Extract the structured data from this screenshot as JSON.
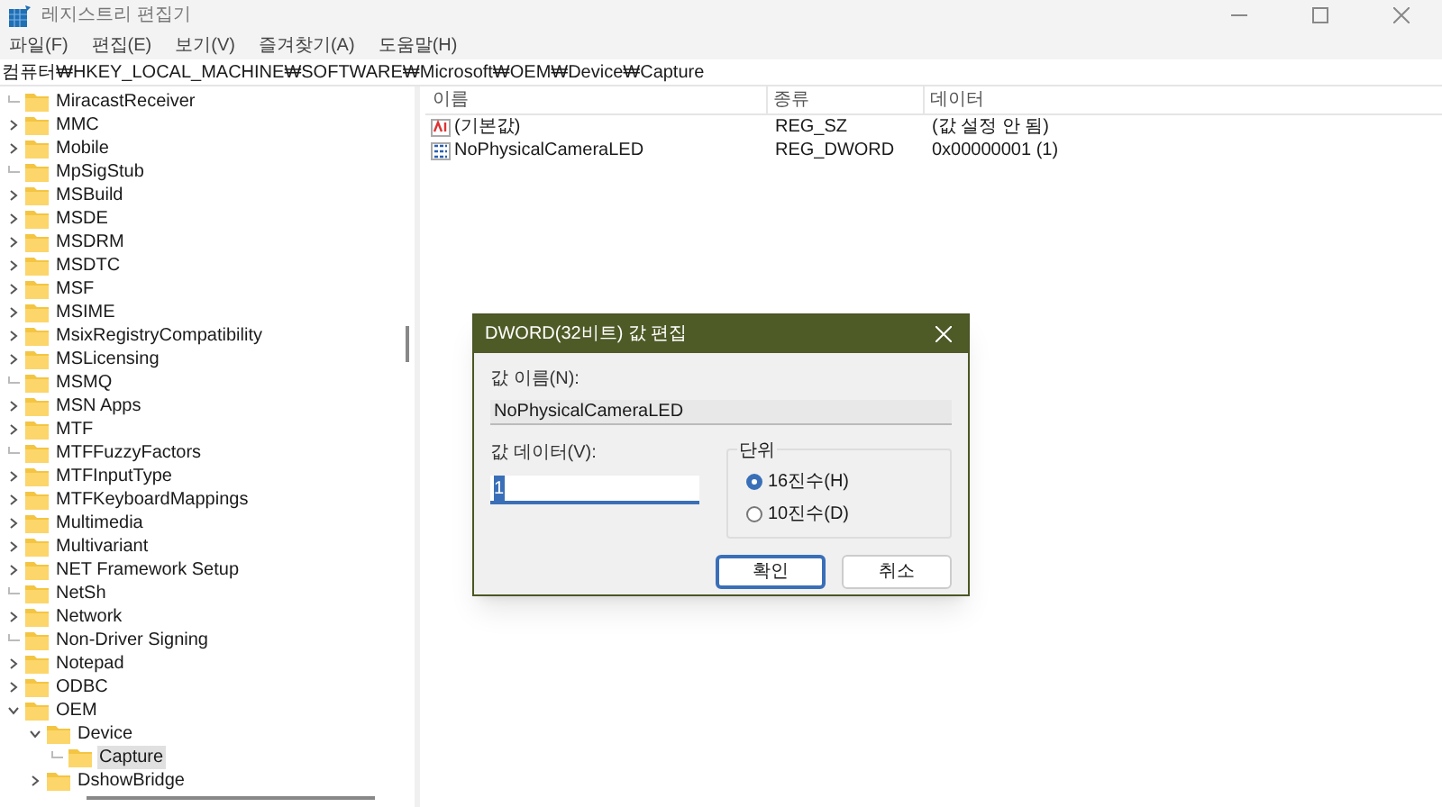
{
  "window": {
    "title": "레지스트리 편집기"
  },
  "menu": [
    "파일(F)",
    "편집(E)",
    "보기(V)",
    "즐겨찾기(A)",
    "도움말(H)"
  ],
  "address": "컴퓨터₩HKEY_LOCAL_MACHINE₩SOFTWARE₩Microsoft₩OEM₩Device₩Capture",
  "tree": [
    {
      "label": "MiracastReceiver",
      "kind": "leaf",
      "selected": false
    },
    {
      "label": "MMC",
      "kind": "collapsed",
      "selected": false
    },
    {
      "label": "Mobile",
      "kind": "collapsed",
      "selected": false
    },
    {
      "label": "MpSigStub",
      "kind": "leaf",
      "selected": false
    },
    {
      "label": "MSBuild",
      "kind": "collapsed",
      "selected": false
    },
    {
      "label": "MSDE",
      "kind": "collapsed",
      "selected": false
    },
    {
      "label": "MSDRM",
      "kind": "collapsed",
      "selected": false
    },
    {
      "label": "MSDTC",
      "kind": "collapsed",
      "selected": false
    },
    {
      "label": "MSF",
      "kind": "collapsed",
      "selected": false
    },
    {
      "label": "MSIME",
      "kind": "collapsed",
      "selected": false
    },
    {
      "label": "MsixRegistryCompatibility",
      "kind": "collapsed",
      "selected": false
    },
    {
      "label": "MSLicensing",
      "kind": "collapsed",
      "selected": false
    },
    {
      "label": "MSMQ",
      "kind": "leaf",
      "selected": false
    },
    {
      "label": "MSN Apps",
      "kind": "collapsed",
      "selected": false
    },
    {
      "label": "MTF",
      "kind": "collapsed",
      "selected": false
    },
    {
      "label": "MTFFuzzyFactors",
      "kind": "leaf",
      "selected": false
    },
    {
      "label": "MTFInputType",
      "kind": "collapsed",
      "selected": false
    },
    {
      "label": "MTFKeyboardMappings",
      "kind": "collapsed",
      "selected": false
    },
    {
      "label": "Multimedia",
      "kind": "collapsed",
      "selected": false
    },
    {
      "label": "Multivariant",
      "kind": "collapsed",
      "selected": false
    },
    {
      "label": "NET Framework Setup",
      "kind": "collapsed",
      "selected": false
    },
    {
      "label": "NetSh",
      "kind": "leaf",
      "selected": false
    },
    {
      "label": "Network",
      "kind": "collapsed",
      "selected": false
    },
    {
      "label": "Non-Driver Signing",
      "kind": "leaf",
      "selected": false
    },
    {
      "label": "Notepad",
      "kind": "collapsed",
      "selected": false
    },
    {
      "label": "ODBC",
      "kind": "collapsed",
      "selected": false
    },
    {
      "label": "OEM",
      "kind": "expanded",
      "selected": false,
      "children": [
        {
          "label": "Device",
          "kind": "expanded",
          "selected": false,
          "children": [
            {
              "label": "Capture",
              "kind": "leaf",
              "selected": true
            }
          ]
        },
        {
          "label": "DshowBridge",
          "kind": "collapsed",
          "selected": false
        }
      ]
    }
  ],
  "values": {
    "columns": [
      "이름",
      "종류",
      "데이터"
    ],
    "rows": [
      {
        "kind": "string",
        "name": "(기본값)",
        "type": "REG_SZ",
        "data": "(값 설정 안 됨)"
      },
      {
        "kind": "binary",
        "name": "NoPhysicalCameraLED",
        "type": "REG_DWORD",
        "data": "0x00000001 (1)"
      }
    ]
  },
  "dialog": {
    "title": "DWORD(32비트) 값 편집",
    "name_label": "값 이름(N):",
    "name_value": "NoPhysicalCameraLED",
    "data_label": "값 데이터(V):",
    "data_value": "1",
    "base_label": "단위",
    "bases": [
      {
        "label": "16진수(H)",
        "selected": true
      },
      {
        "label": "10진수(D)",
        "selected": false
      }
    ],
    "buttons": [
      "확인",
      "취소"
    ]
  }
}
